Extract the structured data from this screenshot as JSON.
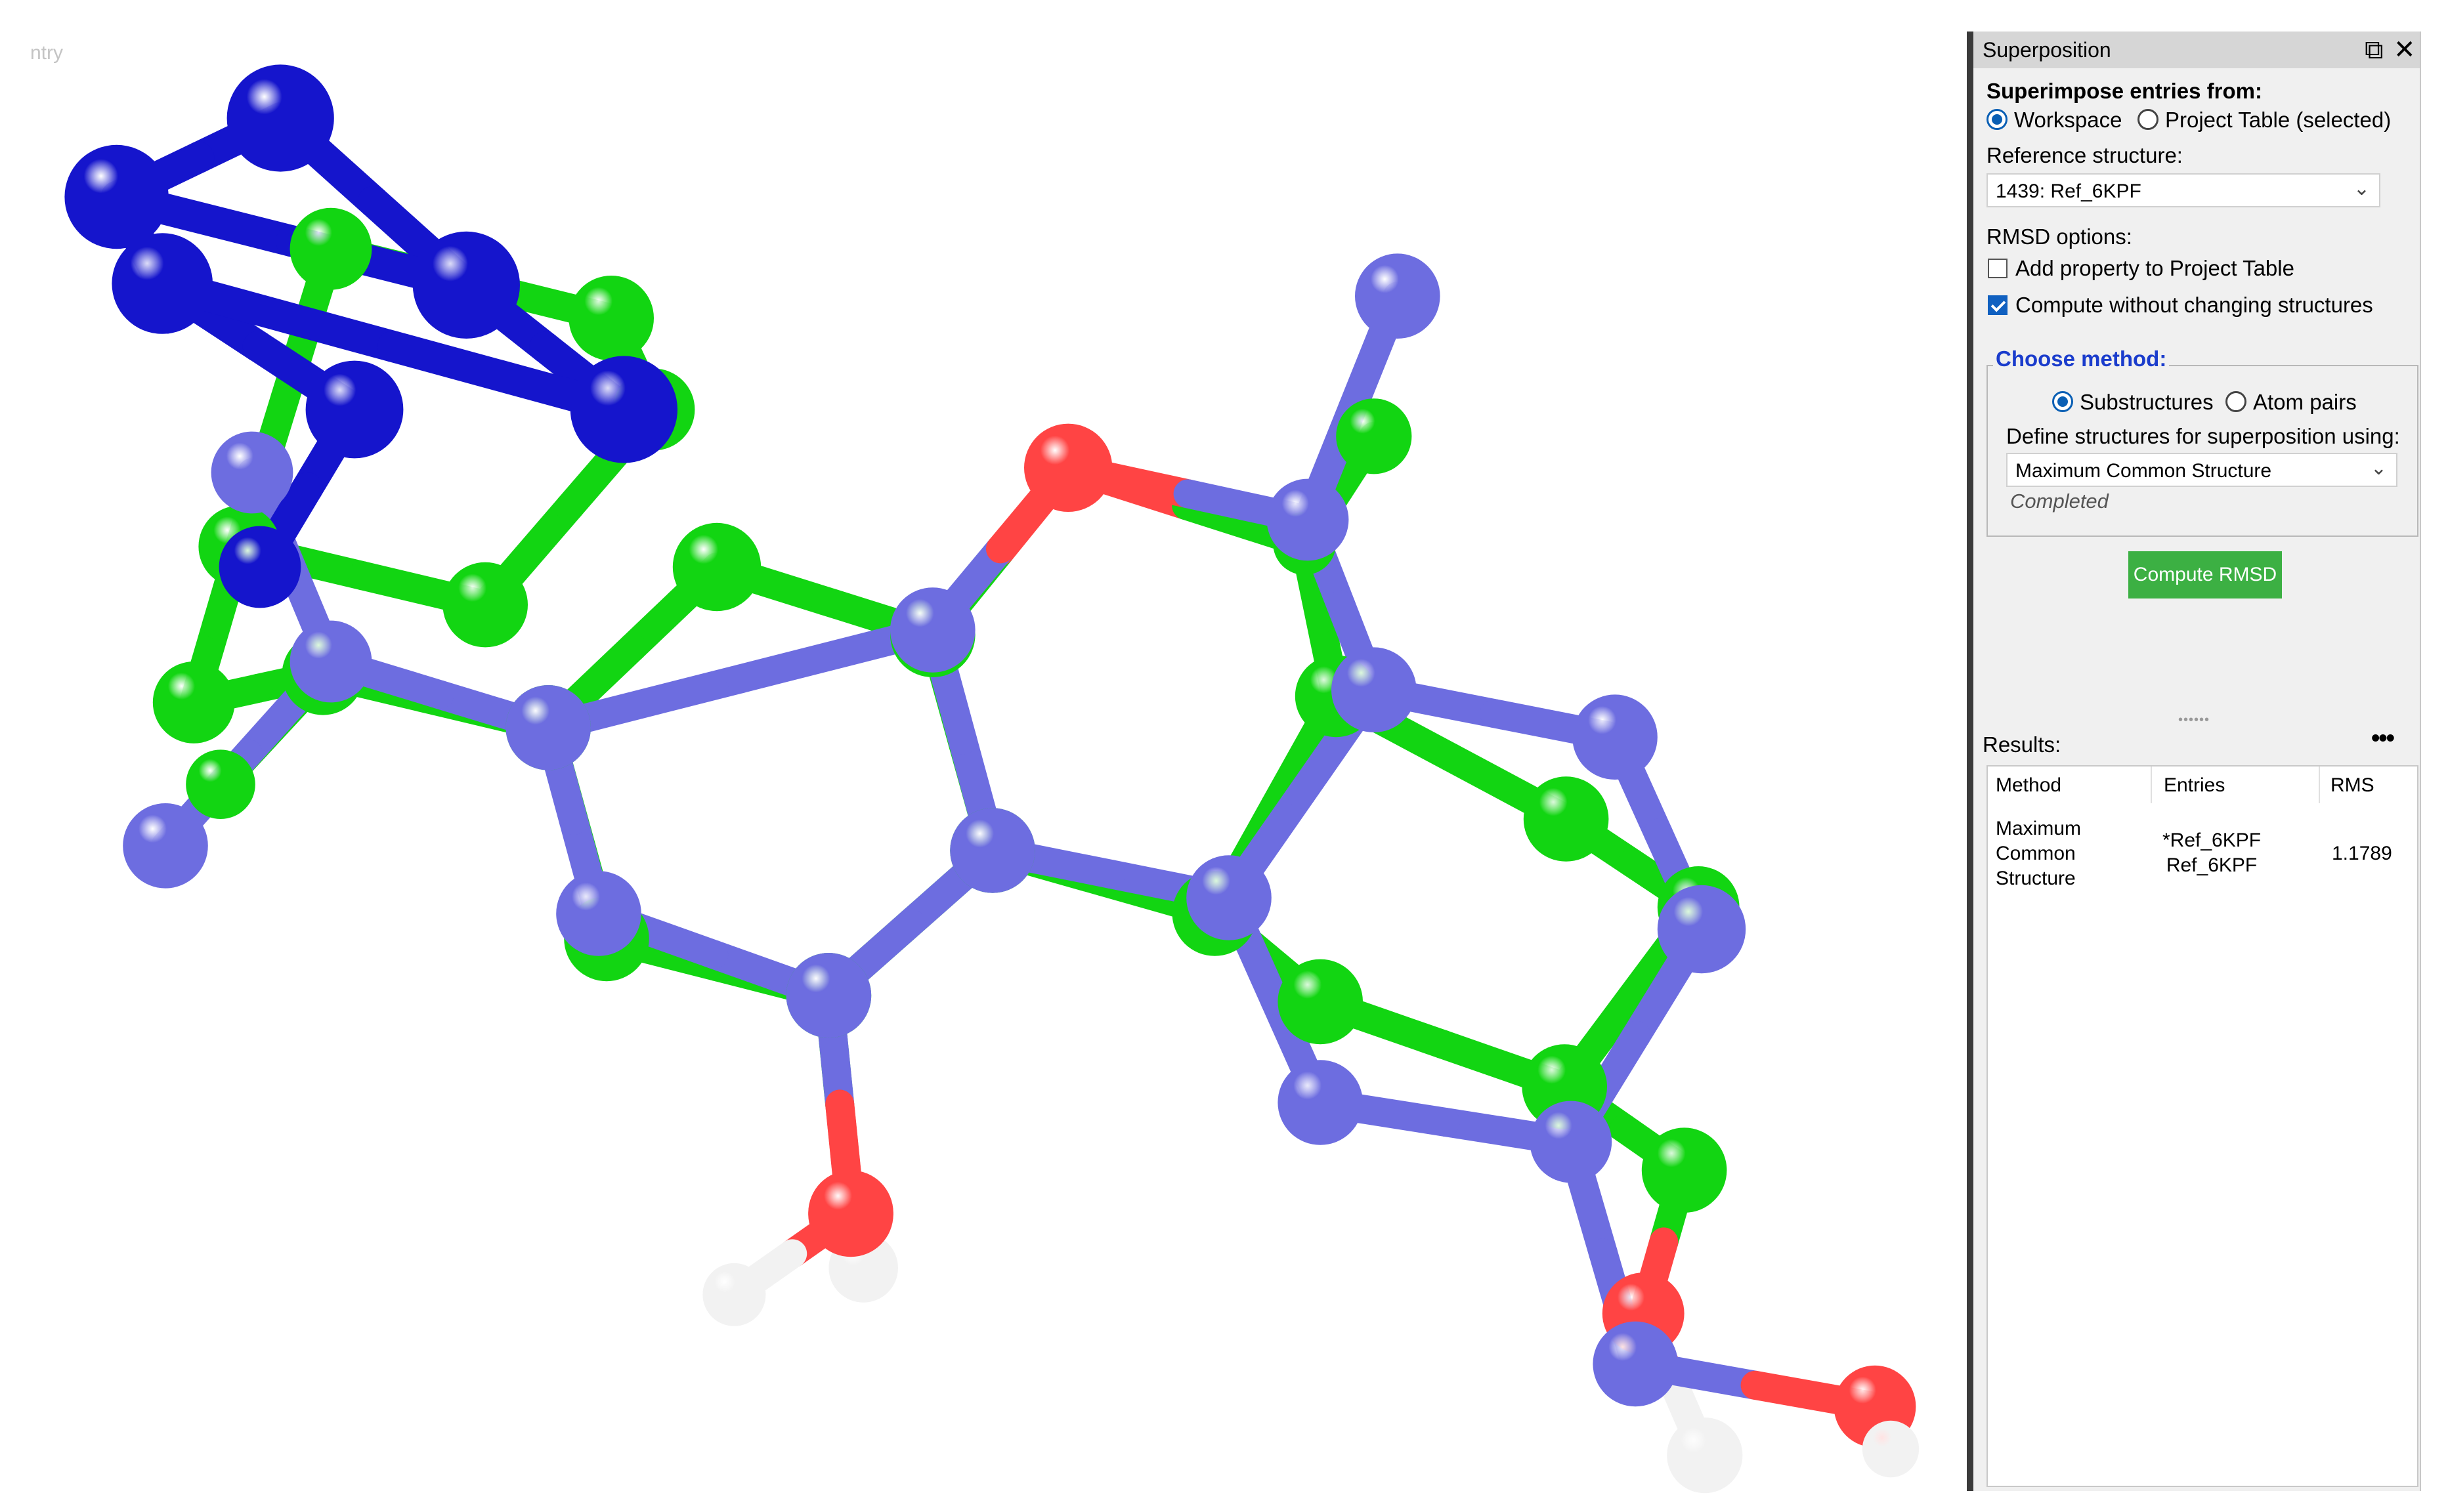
{
  "viewer": {
    "corner_label": "ntry",
    "colors": {
      "green": "#12d512",
      "blue": "#1515cc",
      "slate_blue": "#6d6de0",
      "oxygen": "#ff4444",
      "hydrogen": "#f2f2f2"
    }
  },
  "panel": {
    "title": "Superposition",
    "float_icon": "⧉",
    "close_icon": "✕",
    "superimpose_heading": "Superimpose entries from:",
    "source_options": [
      {
        "label": "Workspace",
        "selected": true
      },
      {
        "label": "Project Table (selected)",
        "selected": false
      }
    ],
    "reference_label": "Reference structure:",
    "reference_value": "1439: Ref_6KPF",
    "rmsd_options_label": "RMSD options:",
    "checkboxes": [
      {
        "label": "Add property to Project Table",
        "checked": false
      },
      {
        "label": "Compute without changing structures",
        "checked": true
      }
    ],
    "choose_method_label": "Choose method:",
    "method_options": [
      {
        "label": "Substructures",
        "selected": true
      },
      {
        "label": "Atom pairs",
        "selected": false
      }
    ],
    "define_label": "Define structures for superposition using:",
    "define_value": "Maximum Common Structure",
    "status": "Completed",
    "compute_button": "Compute RMSD",
    "splitter": "••••••",
    "results_label": "Results:",
    "results_menu": "•••",
    "results_headers": [
      "Method",
      "Entries",
      "RMS"
    ],
    "results_rows": [
      {
        "method": "Maximum\nCommon\nStructure",
        "entries": "*Ref_6KPF\nRef_6KPF",
        "rms": "1.1789"
      }
    ]
  }
}
